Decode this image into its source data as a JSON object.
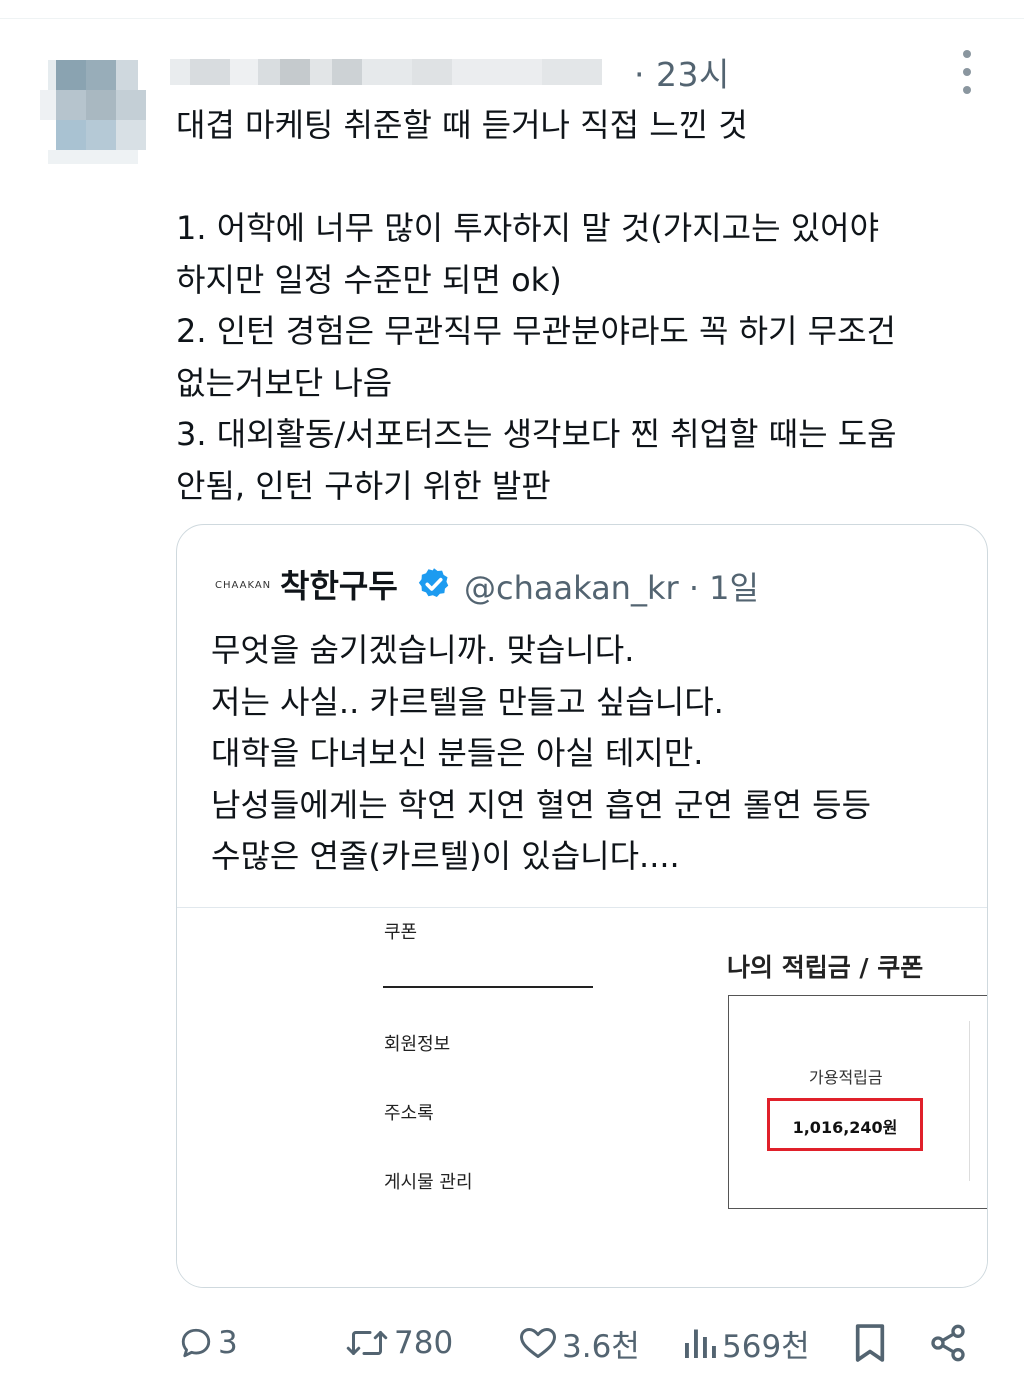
{
  "tweet": {
    "timestamp": "· 23시",
    "text_lines": [
      "대겹 마케팅 취준할 때 듣거나 직접 느낀 것",
      "",
      "1. 어학에 너무 많이 투자하지 말 것(가지고는 있어야",
      "하지만 일정 수준만 되면 ok)",
      "2. 인턴 경험은 무관직무 무관분야라도 꼭 하기 무조건",
      "없는거보단 나음",
      "3. 대외활동/서포터즈는 생각보다 찐 취업할 때는 도움",
      "안됨, 인턴 구하기 위한 발판"
    ]
  },
  "quote": {
    "logo_text": "CHAAKAN",
    "name": "착한구두",
    "handle": "@chaakan_kr · 1일",
    "text_lines": [
      "무엇을 숨기겠습니까. 맞습니다.",
      "저는 사실.. 카르텔을 만들고 싶습니다.",
      "대학을 다녀보신 분들은 아실 테지만.",
      "남성들에게는 학연 지연 혈연 흡연 군연 롤연 등등",
      "수많은 연줄(카르텔)이 있습니다...."
    ],
    "media": {
      "menu_items": [
        "쿠폰",
        "회원정보",
        "주소록",
        "게시물 관리"
      ],
      "section_title": "나의 적립금 / 쿠폰",
      "balance_label": "가용적립금",
      "balance_value": "1,016,240원",
      "highlight_color": "#e0202a"
    }
  },
  "actions": {
    "reply_count": "3",
    "retweet_count": "780",
    "like_count": "3.6천",
    "view_count": "569천"
  },
  "colors": {
    "secondary_text": "#536471",
    "verified_badge": "#1d9bf0",
    "border": "#cfd9de"
  }
}
